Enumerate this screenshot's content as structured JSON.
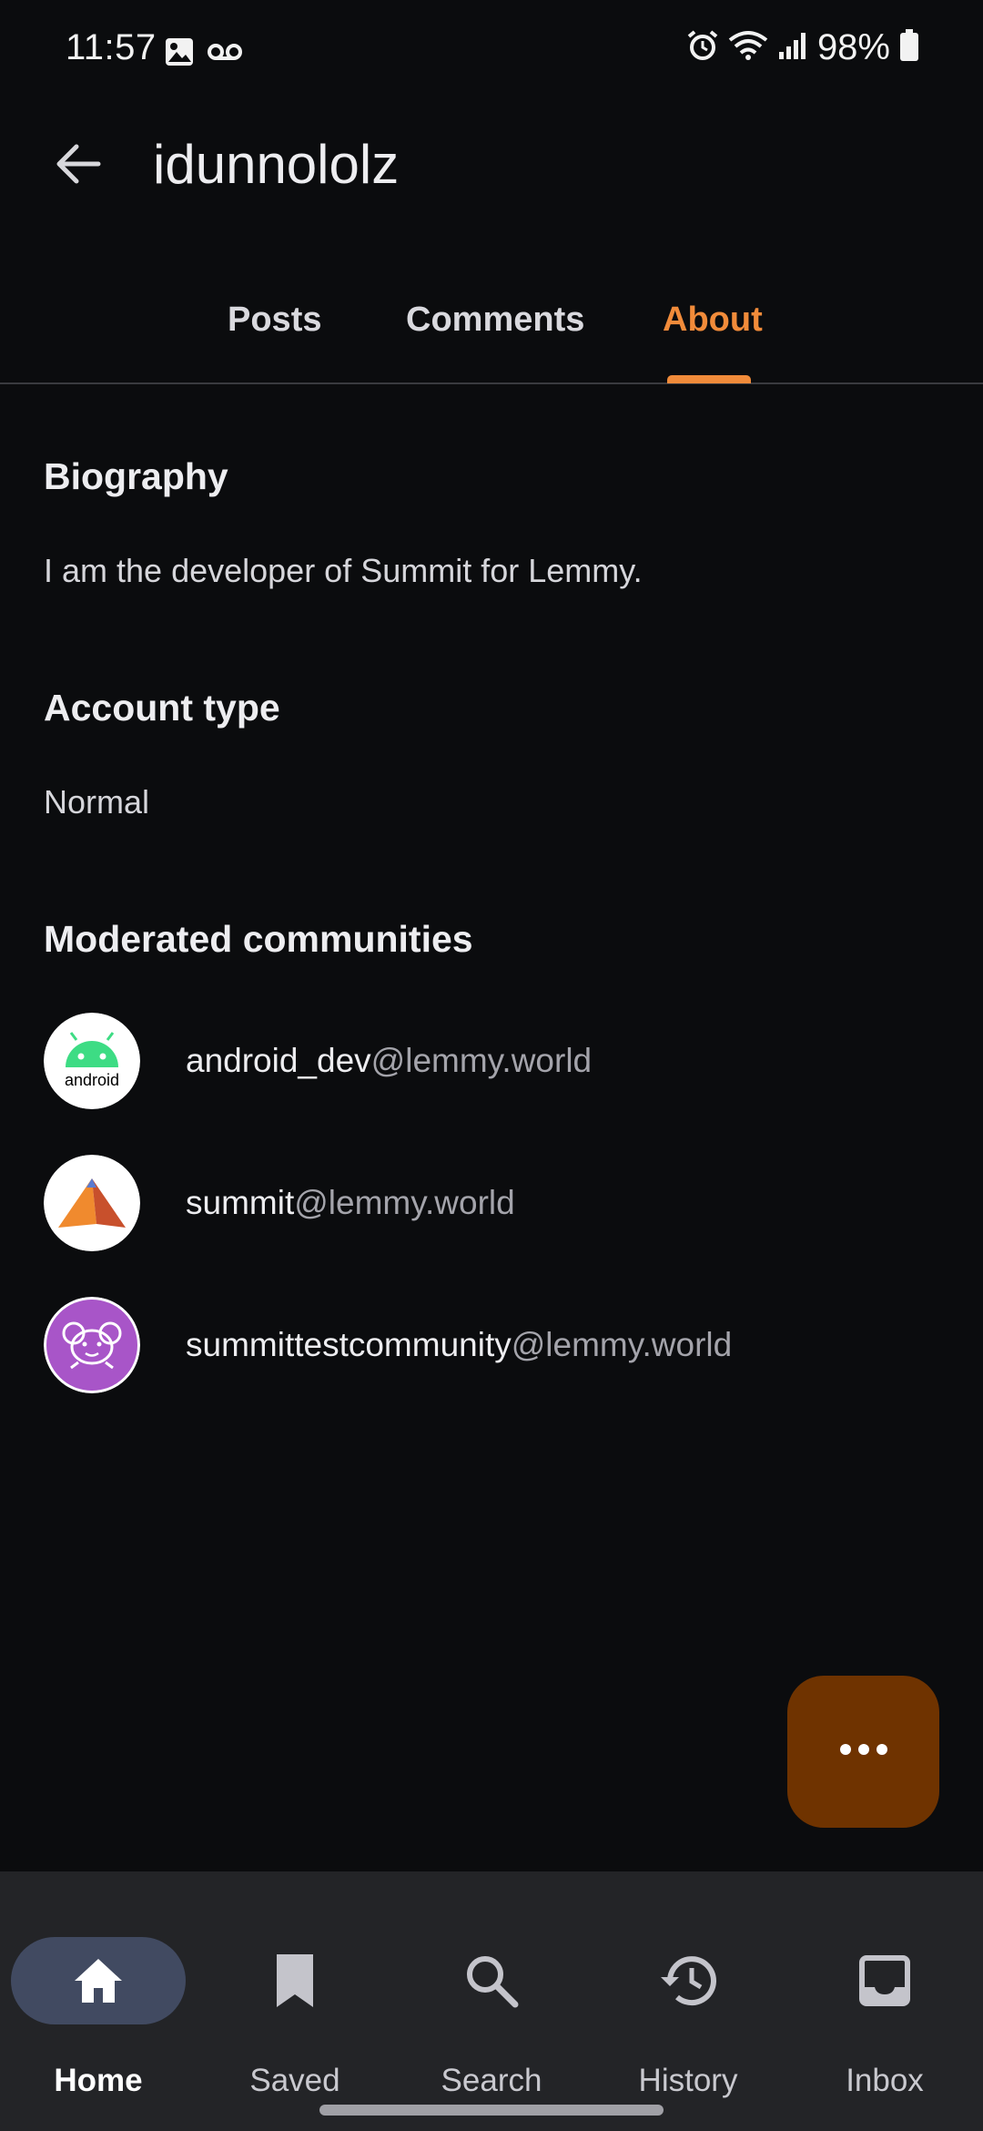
{
  "status_bar": {
    "time": "11:57",
    "battery": "98%",
    "icons": [
      "gallery-icon",
      "voicemail-icon",
      "alarm-icon",
      "wifi-icon",
      "signal-icon",
      "battery-icon"
    ]
  },
  "app_bar": {
    "back_icon": "arrow-back-icon",
    "title": "idunnololz"
  },
  "tabs": [
    {
      "label": "Posts",
      "active": false
    },
    {
      "label": "Comments",
      "active": false
    },
    {
      "label": "About",
      "active": true
    }
  ],
  "about": {
    "biography_heading": "Biography",
    "biography_text": "I am the developer of Summit for Lemmy.",
    "account_type_heading": "Account type",
    "account_type_value": "Normal",
    "moderated_heading": "Moderated communities",
    "communities": [
      {
        "name": "android_dev",
        "instance": "@lemmy.world",
        "icon": "android-logo-icon"
      },
      {
        "name": "summit",
        "instance": "@lemmy.world",
        "icon": "summit-pyramid-icon"
      },
      {
        "name": "summittestcommunity",
        "instance": "@lemmy.world",
        "icon": "lemmy-mascot-icon"
      }
    ]
  },
  "fab": {
    "icon": "more-horiz-icon"
  },
  "bottom_nav": [
    {
      "label": "Home",
      "icon": "home-icon",
      "active": true
    },
    {
      "label": "Saved",
      "icon": "bookmark-icon",
      "active": false
    },
    {
      "label": "Search",
      "icon": "search-icon",
      "active": false
    },
    {
      "label": "History",
      "icon": "history-icon",
      "active": false
    },
    {
      "label": "Inbox",
      "icon": "inbox-icon",
      "active": false
    }
  ],
  "colors": {
    "background": "#0b0c0e",
    "accent": "#f18b3a",
    "fab": "#6f3300",
    "nav_background": "#232427",
    "nav_active_pill": "#414a61"
  }
}
